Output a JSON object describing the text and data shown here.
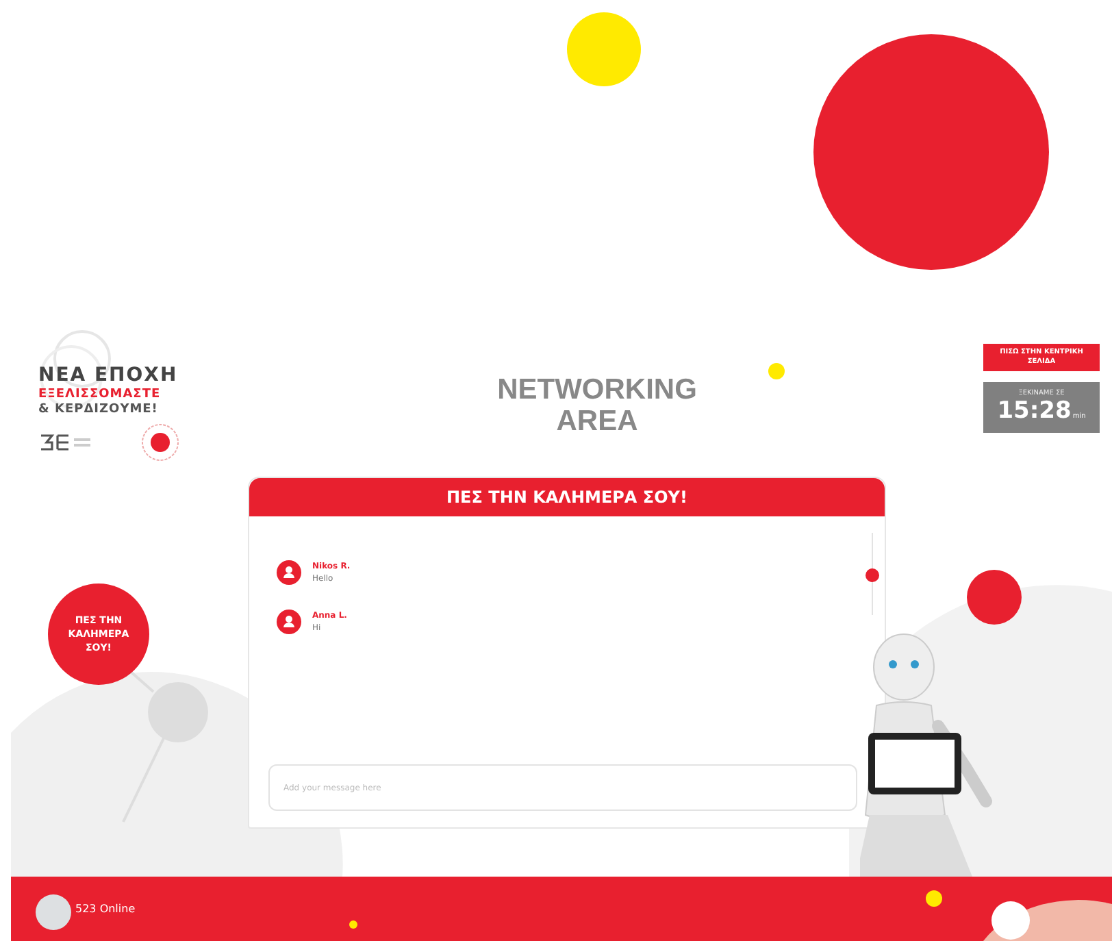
{
  "logo": {
    "line_1": "ΝΕΑ ΕΠΟΧΗ",
    "line_2": "ΕΞΕΛΙΣΣΟΜΑΣΤΕ",
    "line_3": "& ΚΕΡΔΙΖΟΥΜΕ!"
  },
  "title": "NETWORKING AREA",
  "back_button": {
    "label": "ΠΙΣΩ ΣΤΗΝ ΚΕΝΤΡΙΚΗ ΣΕΛΙΔΑ"
  },
  "countdown": {
    "label": "ΞΕΚΙΝΑΜΕ ΣΕ",
    "time": "15:28",
    "unit": "min"
  },
  "nav_bubble": {
    "label": "ΠΕΣ ΤΗΝ ΚΑΛΗΜΕΡΑ ΣΟΥ!"
  },
  "chat": {
    "title": "ΠΕΣ ΤΗΝ ΚΑΛΗΜΕΡΑ ΣΟΥ!",
    "messages": [
      {
        "author": "Nikos R.",
        "text": "Hello"
      },
      {
        "author": "Anna L.",
        "text": "Hi"
      }
    ],
    "input": {
      "placeholder": "Add your message here"
    }
  },
  "footer": {
    "online": "523 Online"
  }
}
